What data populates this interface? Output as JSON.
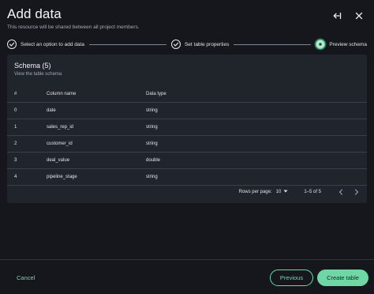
{
  "header": {
    "title": "Add data",
    "subtitle": "This resource will be shared between all project members."
  },
  "steps": [
    {
      "label": "Select an option to add data",
      "state": "completed"
    },
    {
      "label": "Set table properties",
      "state": "completed"
    },
    {
      "label": "Preview schema",
      "state": "current"
    }
  ],
  "schema": {
    "title": "Schema (5)",
    "subtitle": "View the table schema",
    "columns": [
      "#",
      "Column name",
      "Data type"
    ],
    "rows": [
      {
        "index": "0",
        "name": "date",
        "type": "string"
      },
      {
        "index": "1",
        "name": "sales_rep_id",
        "type": "string"
      },
      {
        "index": "2",
        "name": "customer_id",
        "type": "string"
      },
      {
        "index": "3",
        "name": "deal_value",
        "type": "double"
      },
      {
        "index": "4",
        "name": "pipeline_stage",
        "type": "string"
      }
    ]
  },
  "pagination": {
    "rows_per_page_label": "Rows per page:",
    "rows_per_page_value": "10",
    "range": "1–5 of 5"
  },
  "footer": {
    "cancel_label": "Cancel",
    "previous_label": "Previous",
    "create_label": "Create table"
  },
  "colors": {
    "accent": "#6fd7a6",
    "background": "#15171c",
    "panel": "#20242b"
  },
  "icons": {
    "collapse": "arrow-left-to-line-icon",
    "close": "close-icon",
    "step_done": "check-circle-icon",
    "step_current": "dot-circle-icon",
    "dropdown": "caret-down-icon",
    "prev_page": "chevron-left-icon",
    "next_page": "chevron-right-icon"
  }
}
